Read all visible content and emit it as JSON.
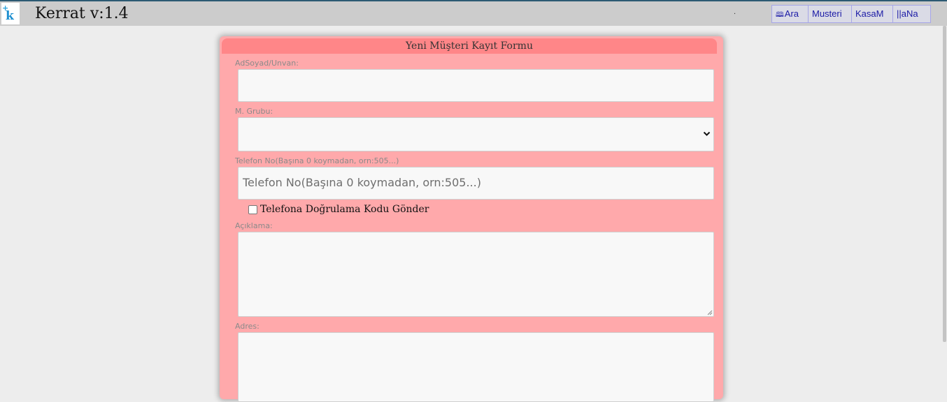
{
  "app": {
    "title": "Kerrat v:1.4",
    "logo_icon": "kerrat-logo-icon",
    "separator_dot": "."
  },
  "nav": {
    "items": [
      {
        "label": "Ara",
        "icon": "search-binoculars-icon"
      },
      {
        "label": "Musteri"
      },
      {
        "label": "KasaM"
      },
      {
        "label": "||aNa"
      }
    ]
  },
  "form": {
    "title": "Yeni Müşteri Kayıt Formu",
    "name_label": "AdSoyad/Unvan:",
    "name_value": "",
    "group_label": "M. Grubu:",
    "group_selected": "",
    "phone_label": "Telefon No(Başına 0 koymadan, orn:505...)",
    "phone_placeholder": "Telefon No(Başına 0 koymadan, orn:505...)",
    "verify_label": "Telefona Doğrulama Kodu Gönder",
    "verify_checked": false,
    "description_label": "Açıklama:",
    "description_value": "",
    "address_label": "Adres:",
    "address_value": ""
  },
  "colors": {
    "card_bg": "#ffa9ab",
    "header_bg": "#ff8688",
    "topbar_bg": "#cccccc",
    "nav_text": "#1a1aa6"
  }
}
